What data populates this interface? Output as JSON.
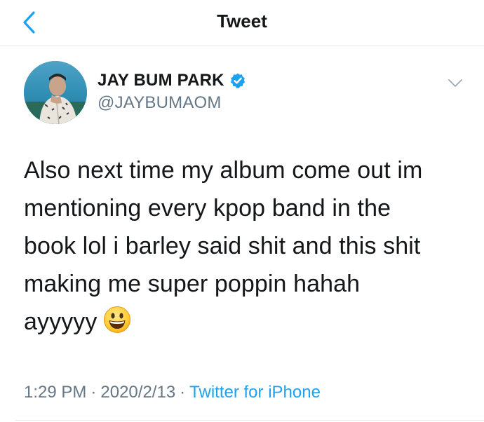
{
  "colors": {
    "accent": "#1da1f2",
    "text_primary": "#14171a",
    "text_secondary": "#657786",
    "divider": "#e1e8ed"
  },
  "header": {
    "title": "Tweet",
    "back_icon": "chevron-left-icon"
  },
  "author": {
    "name": "JAY BUM PARK",
    "handle": "@JAYBUMAOM",
    "verified_icon": "verified-badge-icon",
    "avatar_icon": "avatar-photo",
    "menu_icon": "chevron-down-icon"
  },
  "tweet": {
    "lines": [
      "Also next time my album come out im",
      "mentioning every kpop band in the",
      "book lol i barley said shit and this shit",
      "making me super poppin hahah",
      "ayyyyy"
    ],
    "emoji": "smiling-face-emoji"
  },
  "meta": {
    "time": "1:29 PM",
    "separator": "·",
    "date": "2020/2/13",
    "source": "Twitter for iPhone"
  }
}
